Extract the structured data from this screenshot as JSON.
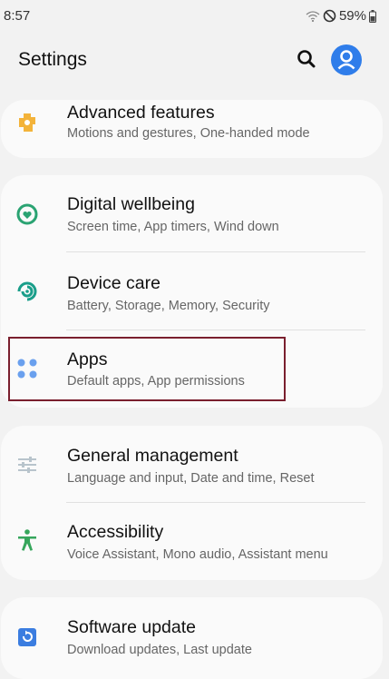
{
  "status_bar": {
    "time": "8:57",
    "battery": "59%"
  },
  "header": {
    "title": "Settings"
  },
  "items": [
    {
      "label": "Advanced features",
      "sub": "Motions and gestures, One-handed mode"
    },
    {
      "label": "Digital wellbeing",
      "sub": "Screen time, App timers, Wind down"
    },
    {
      "label": "Device care",
      "sub": "Battery, Storage, Memory, Security"
    },
    {
      "label": "Apps",
      "sub": "Default apps, App permissions"
    },
    {
      "label": "General management",
      "sub": "Language and input, Date and time, Reset"
    },
    {
      "label": "Accessibility",
      "sub": "Voice Assistant, Mono audio, Assistant menu"
    },
    {
      "label": "Software update",
      "sub": "Download updates, Last update"
    }
  ],
  "colors": {
    "accent_blue": "#2f7dea",
    "advanced_orange": "#f3b33a",
    "wellbeing_green": "#2aa372",
    "device_care_teal": "#1a9e8a",
    "apps_blue": "#6aa0ee",
    "general_gray": "#b8c4cc",
    "accessibility_green": "#36a65c",
    "update_blue": "#3b7de0",
    "highlight_border": "#7a1f2e"
  },
  "icons": [
    "search-icon",
    "profile-icon",
    "gear-puzzle-icon",
    "wellbeing-icon",
    "device-care-icon",
    "apps-grid-icon",
    "sliders-icon",
    "accessibility-icon",
    "software-update-icon"
  ]
}
